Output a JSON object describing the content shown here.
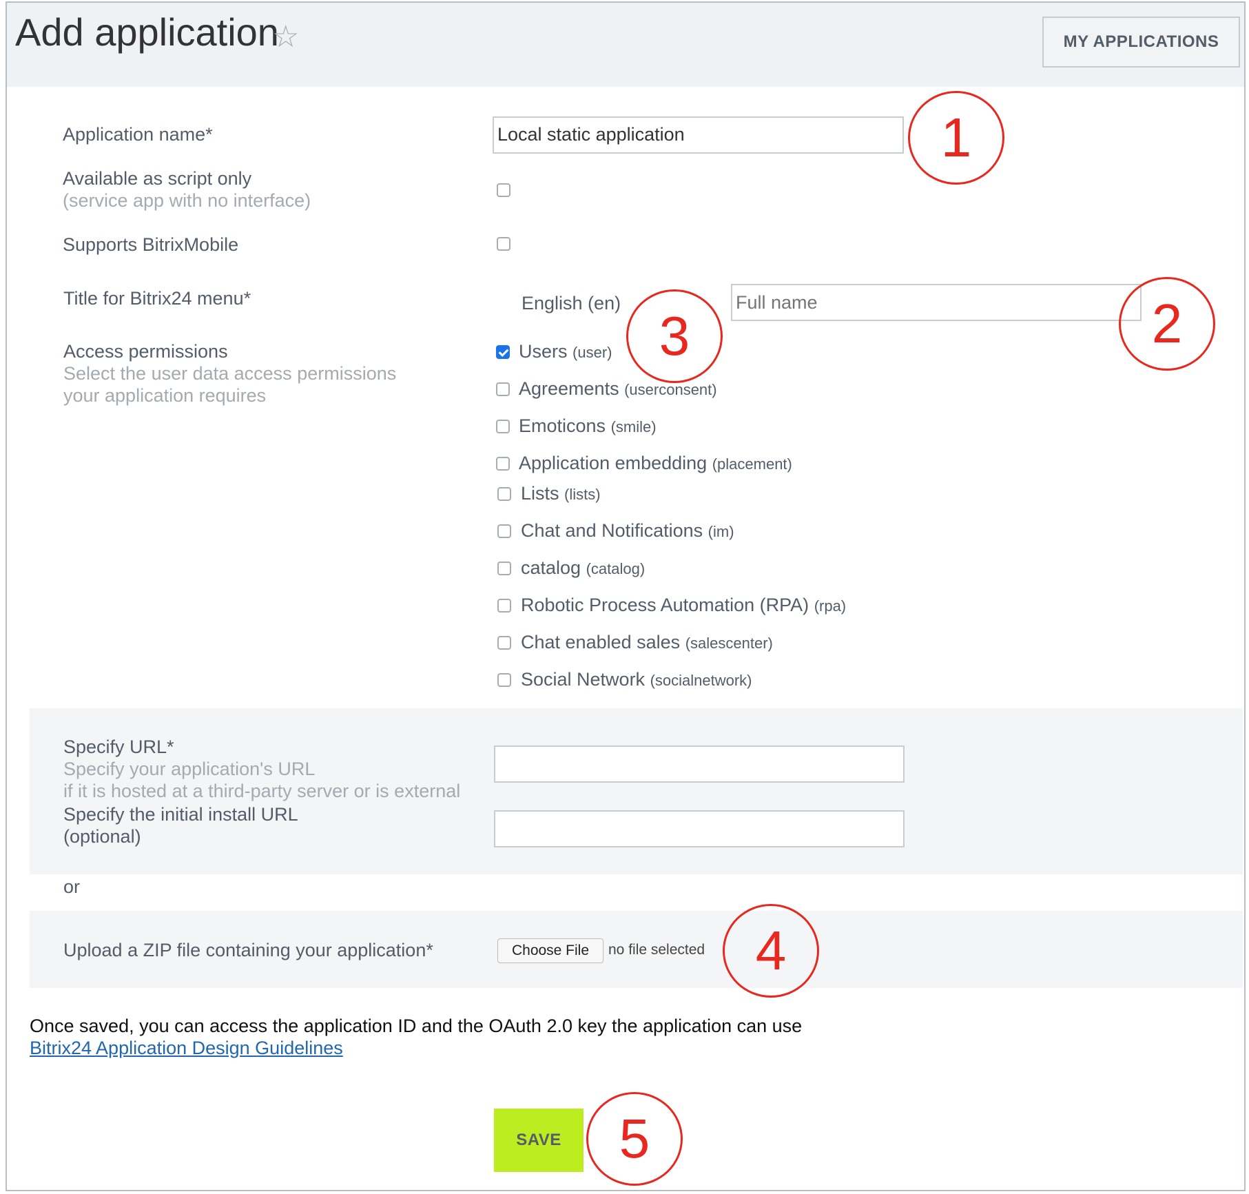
{
  "header": {
    "title": "Add application",
    "star_icon": "star-icon",
    "my_applications_label": "MY APPLICATIONS"
  },
  "form": {
    "app_name": {
      "label": "Application name*",
      "value": "Local static application"
    },
    "script_only": {
      "label": "Available as script only",
      "hint": "(service app with no interface)",
      "checked": false
    },
    "bitrix_mobile": {
      "label": "Supports BitrixMobile",
      "checked": false
    },
    "menu_title": {
      "label": "Title for Bitrix24 menu*",
      "language": "English (en)",
      "placeholder": "Full name",
      "value": ""
    },
    "access": {
      "label": "Access permissions",
      "hint_line1": "Select the user data access permissions",
      "hint_line2": "your application requires",
      "permissions": [
        {
          "name": "Users",
          "code": "(user)",
          "checked": true
        },
        {
          "name": "Agreements",
          "code": "(userconsent)",
          "checked": false
        },
        {
          "name": "Emoticons",
          "code": "(smile)",
          "checked": false
        },
        {
          "name": "Application embedding",
          "code": "(placement)",
          "checked": false
        },
        {
          "name": "Lists",
          "code": "(lists)",
          "checked": false
        },
        {
          "name": "Chat and Notifications",
          "code": "(im)",
          "checked": false
        },
        {
          "name": "catalog",
          "code": "(catalog)",
          "checked": false
        },
        {
          "name": "Robotic Process Automation (RPA)",
          "code": "(rpa)",
          "checked": false
        },
        {
          "name": "Chat enabled sales",
          "code": "(salescenter)",
          "checked": false
        },
        {
          "name": "Social Network",
          "code": "(socialnetwork)",
          "checked": false
        }
      ]
    },
    "url": {
      "label": "Specify URL*",
      "hint_line1": "Specify your application's URL",
      "hint_line2": "if it is hosted at a third-party server or is external",
      "value": ""
    },
    "install_url": {
      "label_line1": "Specify the initial install URL",
      "label_line2": "(optional)",
      "value": ""
    },
    "or_text": "or",
    "zip": {
      "label": "Upload a ZIP file containing your application*",
      "button": "Choose File",
      "status": "no file selected"
    }
  },
  "footer": {
    "note": "Once saved, you can access the application ID and the OAuth 2.0 key the application can use",
    "link": "Bitrix24 Application Design Guidelines",
    "save_label": "SAVE"
  },
  "callouts": [
    "1",
    "2",
    "3",
    "4",
    "5"
  ],
  "colors": {
    "header_bg": "#eef2f4",
    "save_green": "#bbed21",
    "callout_red": "#e8281e",
    "link_blue": "#2067b0",
    "checkbox_blue": "#1a73e8"
  }
}
